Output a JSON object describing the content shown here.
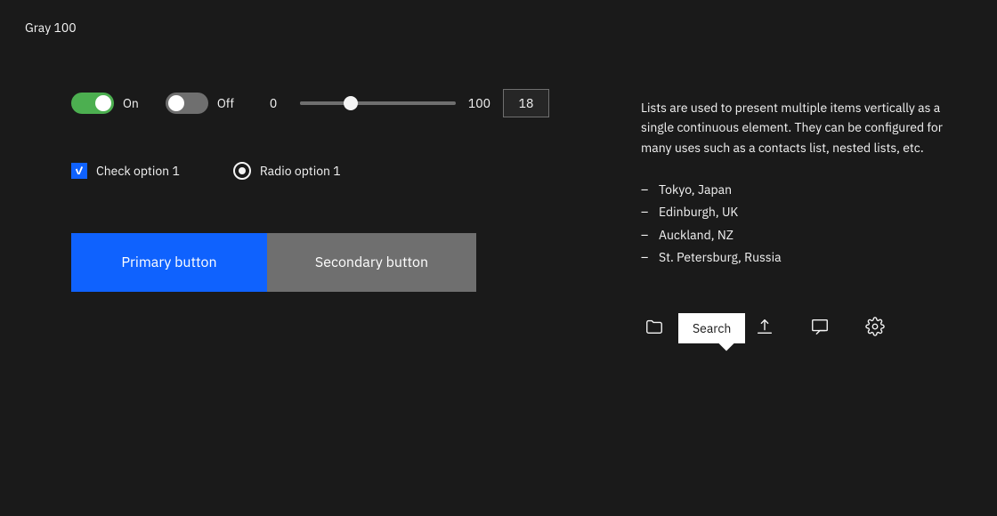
{
  "page": {
    "title": "Gray 100",
    "background": "#1a1a1a"
  },
  "toggles": {
    "on_label": "On",
    "off_label": "Off"
  },
  "slider": {
    "min": "0",
    "max": "100",
    "value": "18"
  },
  "checkbox": {
    "label": "Check option 1"
  },
  "radio": {
    "label": "Radio option 1"
  },
  "buttons": {
    "primary": "Primary button",
    "secondary": "Secondary button"
  },
  "list": {
    "description": "Lists are used to present multiple items vertically as a single continuous element. They can be configured for many uses such as a contacts list, nested lists, etc.",
    "items": [
      "Tokyo, Japan",
      "Edinburgh, UK",
      "Auckland, NZ",
      "St. Petersburg, Russia"
    ]
  },
  "search_tooltip": "Search",
  "icons": {
    "folder": "folder-icon",
    "search": "search-icon",
    "upload": "upload-icon",
    "chat": "chat-icon",
    "settings": "settings-icon"
  }
}
